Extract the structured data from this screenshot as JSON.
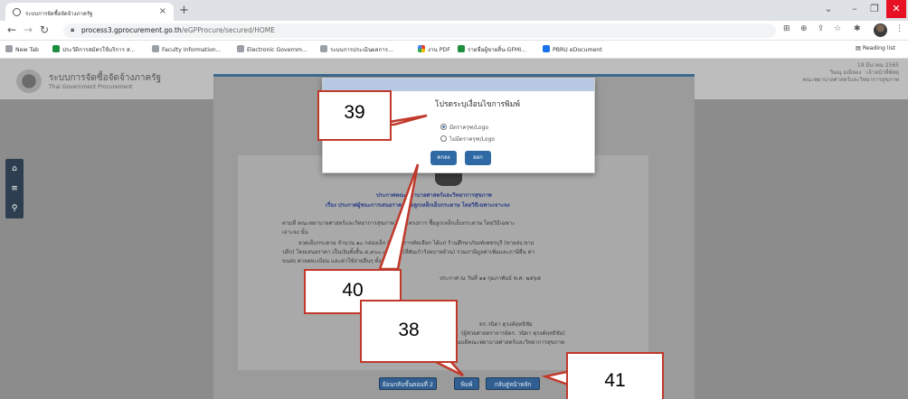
{
  "browser": {
    "tab_title": "ระบบการจัดซื้อจัดจ้างภาครัฐ",
    "url_host": "process3.gprocurement.go.th",
    "url_path": "/eGPProcure/secured/HOME",
    "bookmarks": [
      {
        "label": "New Tab",
        "icon": "globe-icon"
      },
      {
        "label": "ประวัติการสมัครใช้บริการ ส...",
        "icon": "sheets-icon"
      },
      {
        "label": "Faculty Information...",
        "icon": "globe-icon"
      },
      {
        "label": "Electronic Governm...",
        "icon": "globe-icon"
      },
      {
        "label": "ระบบการประเมินผลการ...",
        "icon": "globe-icon"
      },
      {
        "label": "งาน PDF",
        "icon": "drive-icon"
      },
      {
        "label": "รายชื่อผู้ขายสิ้น-GFMI...",
        "icon": "sheets-icon"
      },
      {
        "label": "PBRU eDocument",
        "icon": "doc-icon"
      }
    ],
    "reading_list": "Reading list"
  },
  "site": {
    "title": "ระบบการจัดซื้อจัดจ้างภาครัฐ",
    "subtitle": "Thai Government Procurement",
    "date_line1": "19 มีนาคม 2565",
    "date_line2": "วิษณุ มณีทอง · เจ้าหน้าที่พัสดุ",
    "date_line3": "คณะพยาบาลศาสตร์และวิทยาการสุขภาพ"
  },
  "document": {
    "line1": "ประกาศคณะพยาบาลศาสตร์และวิทยาการสุขภาพ",
    "line2": "เรื่อง ประกาศผู้ชนะการเสนอราคา ซื้อลูกเหล็กเย็บกระดาษ โดยวิธีเฉพาะเจาะจง",
    "line3": "ตามที่ คณะพยาบาลศาสตร์และวิทยาการสุขภาพ ได้มีโครงการ ซื้อลูกเหล็กเย็บกระดาษ โดยวิธีเฉพาะ",
    "line4": "เจาะจง นั้น",
    "line5": "ลวดเย็บกระดาษ จำนวน ๑๐ กล่องเล็ก ผู้ได้รับการคัดเลือก ได้แก่ ร้านศึกษาภัณฑ์เพชรบุรี (ขายส่ง,ขาย",
    "line6": "ปลีก) โดยเสนอราคา เป็นเงินทั้งสิ้น ๔,๙๐๐.๐๐ บาท (สี่พันเก้าร้อยบาทถ้วน) รวมภาษีมูลค่าเพิ่มและภาษีอื่น ค่า",
    "line7": "ขนส่ง ค่าจดทะเบียน และค่าใช้จ่ายอื่นๆ ทั้งปวง",
    "line8": "ประกาศ ณ วันที่ ๑๑ กุมภาพันธ์ พ.ศ. ๒๕๖๕",
    "sign1": "ดร.วนิดา ดุรงค์ฤทธิชัย",
    "sign2": "(ผู้ช่วยศาสตราจารย์ดร. วนิดา ดุรงค์ฤทธิชัย)",
    "sign3": "คณบดีคณะพยาบาลศาสตร์และวิทยาการสุขภาพ"
  },
  "buttons": {
    "back_step": "ย้อนกลับขั้นตอนที่ 2",
    "print": "พิมพ์",
    "home": "กลับสู่หน้าหลัก"
  },
  "dialog": {
    "title": "โปรดระบุเงื่อนไขการพิมพ์",
    "option1": "มีตราครุฑ/Logo",
    "option2": "ไม่มีตราครุฑ/Logo",
    "ok": "ตกลง",
    "cancel": "ออก"
  },
  "callouts": {
    "c38": "38",
    "c39": "39",
    "c40": "40",
    "c41": "41"
  },
  "colors": {
    "callout_border": "#c0392b",
    "button_blue": "#325f91",
    "panel_border": "#3c6a8f"
  }
}
